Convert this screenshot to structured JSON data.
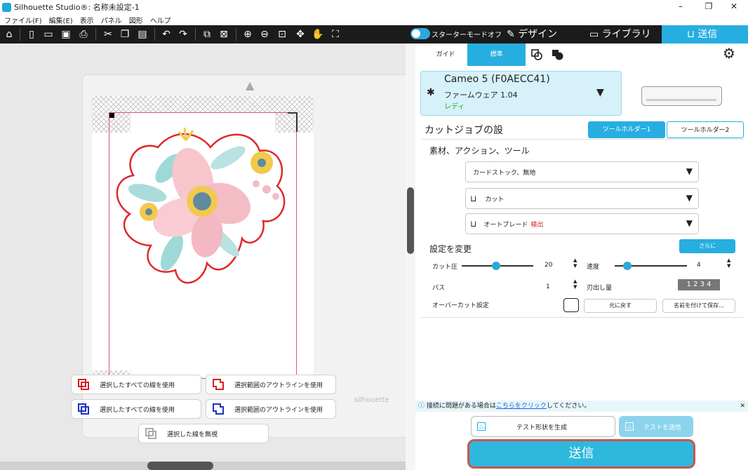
{
  "window": {
    "title": "Silhouette Studio®: 名称未設定-1",
    "controls": [
      "–",
      "❐",
      "✕"
    ]
  },
  "menu": [
    "ファイル(F)",
    "編集(E)",
    "表示",
    "パネル",
    "図形",
    "ヘルプ"
  ],
  "toolbar": {
    "starter_mode": "スターターモードオフ",
    "tabs": {
      "design": "デザイン",
      "library": "ライブラリ",
      "send": "送信"
    }
  },
  "canvas": {
    "watermark": "silhouette",
    "actions": [
      {
        "label": "選択したすべての線を使用",
        "color": "#d62020"
      },
      {
        "label": "選択範囲のアウトラインを使用",
        "color": "#d62020"
      },
      {
        "label": "選択したすべての線を使用",
        "color": "#1f2fc8"
      },
      {
        "label": "選択範囲のアウトラインを使用",
        "color": "#1f2fc8"
      },
      {
        "label": "選択した線を無視",
        "color": "#aaaaaa"
      }
    ]
  },
  "panel": {
    "modes": {
      "guide": "ガイド",
      "standard": "標準"
    },
    "device": {
      "name": "Cameo 5 (F0AECC41)",
      "firmware": "ファームウェア 1.04",
      "status": "レディ"
    },
    "job_title": "カットジョブの設",
    "tool_holders": [
      "ツールホルダー1",
      "ツールホルダー2"
    ],
    "material_section": "素材、アクション、ツール",
    "material": "カードストック、無地",
    "action": "カット",
    "tool": "オートブレード",
    "tool_detected": "検出",
    "settings_title": "設定を変更",
    "more_button": "さらに",
    "force_label": "カット圧",
    "force_value": "20",
    "speed_label": "速度",
    "speed_value": "4",
    "passes_label": "パス",
    "passes_value": "1",
    "blade_label": "刃出し量",
    "blade_digits": "1 2 3 4",
    "overcut_label": "オーバーカット設定",
    "reset_button": "元に戻す",
    "save_button": "名前を付けて保存...",
    "info_prefix": "接続に問題がある場合は",
    "info_link": "こちらをクリック",
    "info_suffix": "してください。",
    "test_shape_button": "テスト形状を生成",
    "test_send_button": "テストを送信",
    "send_button": "送信"
  }
}
